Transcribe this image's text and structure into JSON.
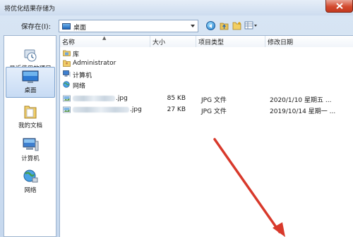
{
  "window": {
    "title": "将优化结果存储为"
  },
  "toolbar": {
    "save_in_label": "保存在(I):",
    "location": "桌面"
  },
  "places": [
    {
      "label": "最近使用的项目",
      "icon": "recent-items-icon"
    },
    {
      "label": "桌面",
      "icon": "desktop-icon",
      "selected": true
    },
    {
      "label": "我的文档",
      "icon": "documents-icon"
    },
    {
      "label": "计算机",
      "icon": "computer-icon"
    },
    {
      "label": "网络",
      "icon": "network-icon"
    }
  ],
  "columns": {
    "name": "名称",
    "size": "大小",
    "type": "项目类型",
    "date": "修改日期"
  },
  "items": [
    {
      "name": "库",
      "icon": "library-icon"
    },
    {
      "name": "Administrator",
      "icon": "user-folder-icon"
    },
    {
      "name": "计算机",
      "icon": "computer-icon"
    },
    {
      "name": "网络",
      "icon": "network-icon"
    },
    {
      "name": ".jpg",
      "size": "85 KB",
      "type": "JPG 文件",
      "date": "2020/1/10 星期五 ...",
      "icon": "image-file-icon"
    },
    {
      "name": ".jpg",
      "size": "27 KB",
      "type": "JPG 文件",
      "date": "2019/10/14 星期一 ...",
      "icon": "image-file-icon"
    }
  ],
  "colors": {
    "accent": "#d8392b",
    "selection": "#c7dbf4",
    "close": "#c3391f"
  }
}
